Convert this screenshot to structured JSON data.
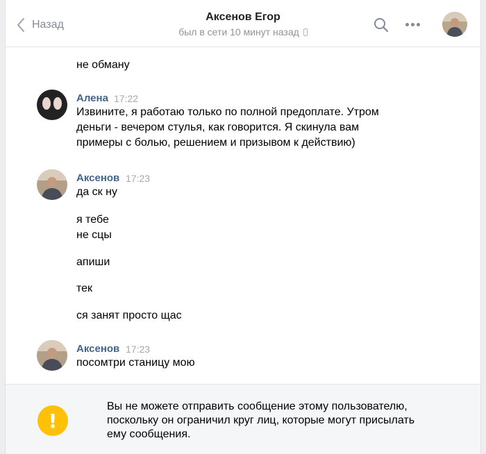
{
  "header": {
    "back_label": "Назад",
    "contact_name": "Аксенов Егор",
    "status": "был в сети 10 минут назад",
    "status_icon": "phone-icon"
  },
  "messages": {
    "tail": {
      "text": "не обману"
    },
    "alena": {
      "author": "Алена",
      "time": "17:22",
      "lines": [
        "Извините, я работаю только по полной предоплате. Утром",
        "деньги - вечером стулья, как говорится. Я скинула вам",
        "примеры с болью, решением и призывом к действию)"
      ]
    },
    "aksenov1": {
      "author": "Аксенов",
      "time": "17:23",
      "texts": [
        "да ск ну",
        "я тебе",
        "не сцы",
        "апиши",
        "тек",
        "ся занят просто щас"
      ]
    },
    "aksenov2": {
      "author": "Аксенов",
      "time": "17:23",
      "text": "посомтри станицу мою"
    }
  },
  "footer": {
    "icon": "exclamation-icon",
    "notice_lines": [
      "Вы не можете отправить сообщение этому пользователю,",
      "поскольку он ограничил круг лиц, которые могут присылать",
      "ему сообщения."
    ]
  },
  "colors": {
    "author": "#42648b",
    "time": "#a4a7ac",
    "warning": "#ffc107",
    "footer_bg": "#f5f6f8"
  }
}
